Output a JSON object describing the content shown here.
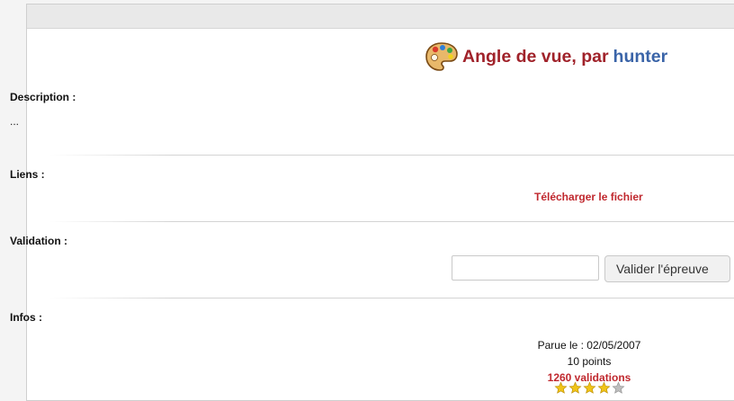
{
  "title": {
    "challenge": "Angle de vue, par",
    "author": "hunter",
    "icon": "palette-icon"
  },
  "sections": {
    "description": {
      "label": "Description :",
      "text": "..."
    },
    "links": {
      "label": "Liens :",
      "download": "Télécharger le fichier"
    },
    "validation": {
      "label": "Validation :",
      "input_value": "",
      "input_placeholder": "",
      "button": "Valider l'épreuve"
    },
    "infos": {
      "label": "Infos :",
      "published": "Parue le : 02/05/2007",
      "points": "10 points",
      "validations": "1260 validations",
      "rating": 4,
      "rating_max": 5
    }
  },
  "colors": {
    "title": "#a0222a",
    "author": "#3a64a8",
    "link": "#c0282e",
    "star_filled": "#f0c419",
    "star_empty": "#bdbdbd"
  }
}
